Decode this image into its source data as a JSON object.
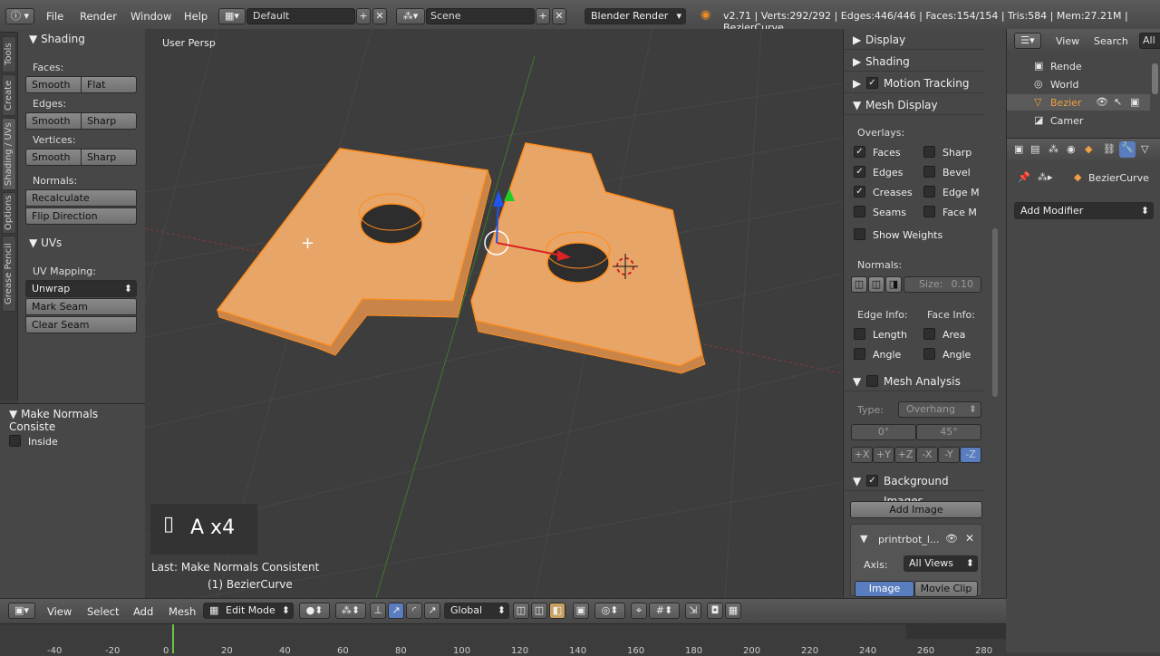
{
  "topbar": {
    "menu": [
      "File",
      "Render",
      "Window",
      "Help"
    ],
    "layout_name": "Default",
    "scene_name": "Scene",
    "engine": "Blender Render",
    "stats": "v2.71 | Verts:292/292 | Edges:446/446 | Faces:154/154 | Tris:584 | Mem:27.21M | BezierCurve"
  },
  "left_tabs": [
    "Tools",
    "Create",
    "Shading / UVs",
    "Options",
    "Grease Pencil"
  ],
  "shading_panel": {
    "title": "Shading",
    "faces_label": "Faces:",
    "edges_label": "Edges:",
    "vertices_label": "Vertices:",
    "normals_label": "Normals:",
    "smooth": "Smooth",
    "flat": "Flat",
    "sharp": "Sharp",
    "recalculate": "Recalculate",
    "flip_direction": "Flip Direction"
  },
  "uvs_panel": {
    "title": "UVs",
    "mapping_label": "UV Mapping:",
    "unwrap": "Unwrap",
    "mark_seam": "Mark Seam",
    "clear_seam": "Clear Seam"
  },
  "operator_panel": {
    "title": "Make Normals Consiste",
    "inside_label": "Inside"
  },
  "viewport": {
    "view_label": "User Persp",
    "key_overlay": "A x4",
    "last_op": "Last: Make Normals Consistent",
    "object_label": "(1) BezierCurve"
  },
  "properties": {
    "display": "Display",
    "shading": "Shading",
    "motion_tracking": "Motion Tracking",
    "mesh_display": "Mesh Display",
    "overlays_label": "Overlays:",
    "overlays_left": [
      "Faces",
      "Edges",
      "Creases",
      "Seams",
      "Show Weights"
    ],
    "overlays_left_checked": [
      true,
      true,
      true,
      false,
      false
    ],
    "overlays_right": [
      "Sharp",
      "Bevel",
      "Edge M",
      "Face M"
    ],
    "normals_label": "Normals:",
    "size_label": "Size:",
    "size_value": "0.10",
    "edge_info_label": "Edge Info:",
    "face_info_label": "Face Info:",
    "length": "Length",
    "angle": "Angle",
    "area": "Area",
    "face_angle": "Angle",
    "mesh_analysis": "Mesh Analysis",
    "type_label": "Type:",
    "type_value": "Overhang",
    "angle_min": "0°",
    "angle_max": "45°",
    "axes": [
      "+X",
      "+Y",
      "+Z",
      "-X",
      "-Y",
      "-Z"
    ],
    "background_images": "Background Images",
    "add_image": "Add Image",
    "image_name": "printrbot_l...",
    "axis_label": "Axis:",
    "axis_value": "All Views",
    "image_tab": "Image",
    "movie_clip_tab": "Movie Clip"
  },
  "outliner": {
    "view": "View",
    "search": "Search",
    "filter": "All S",
    "items": [
      "Rende",
      "World",
      "Bezier",
      "Camer"
    ]
  },
  "property_editor": {
    "object_name": "BezierCurve",
    "add_modifier": "Add Modifier"
  },
  "bottombar": {
    "view": "View",
    "select": "Select",
    "add": "Add",
    "mesh": "Mesh",
    "mode": "Edit Mode",
    "orientation": "Global"
  },
  "timeline": {
    "ticks": [
      "-40",
      "-20",
      "0",
      "20",
      "40",
      "60",
      "80",
      "100",
      "120",
      "140",
      "160",
      "180",
      "200",
      "220",
      "240",
      "260",
      "280"
    ]
  }
}
